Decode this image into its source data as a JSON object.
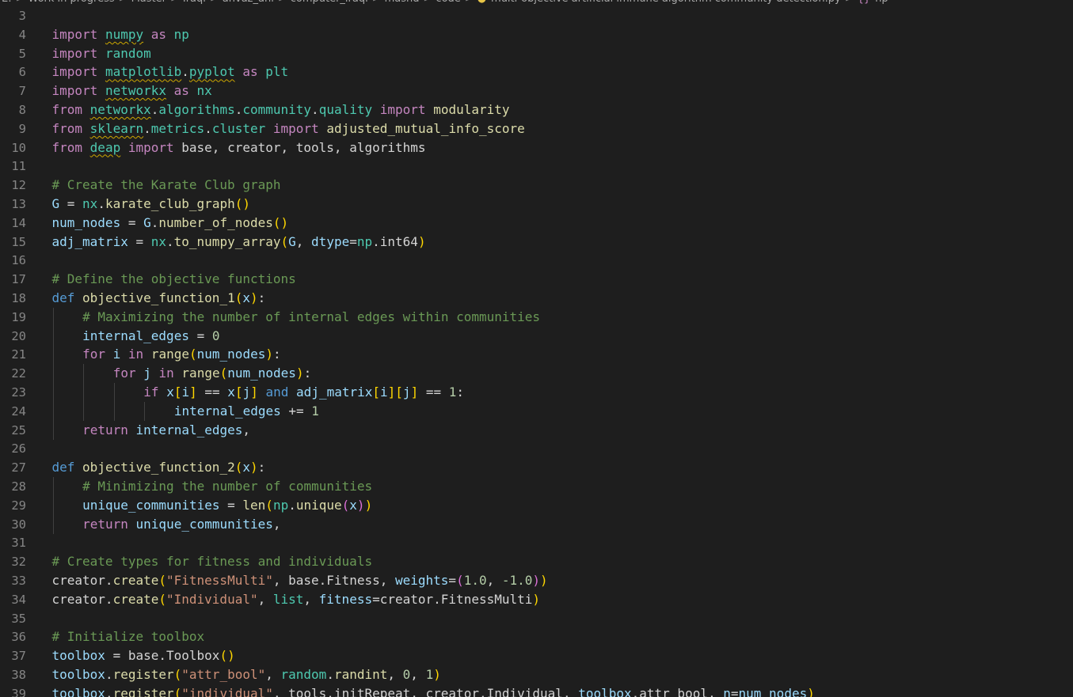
{
  "breadcrumb": {
    "items": [
      "E:",
      "Work in progress",
      "Master",
      "Iraqi",
      "anvaz_ahi",
      "computer_iraqi",
      "mashd",
      "code",
      "multi-objective artificial immune algorithm community detection.py",
      "np"
    ],
    "file_icon": "python-file-icon",
    "symbol_icon": "symbol-braces-icon"
  },
  "editor": {
    "language": "python",
    "theme_colors": {
      "background": "#1e1e1e",
      "keyword": "#c586c0",
      "module": "#4ec9b0",
      "function": "#dcdcaa",
      "variable": "#9cdcfe",
      "comment": "#6a9955",
      "string": "#ce9178",
      "number": "#b5cea8",
      "warning_squiggle": "#cca700"
    },
    "lines": [
      {
        "n": "3",
        "tokens": []
      },
      {
        "n": "4",
        "tokens": [
          [
            "kw",
            "import"
          ],
          [
            "op",
            " "
          ],
          [
            "mod wavy",
            "numpy"
          ],
          [
            "op",
            " "
          ],
          [
            "kw",
            "as"
          ],
          [
            "op",
            " "
          ],
          [
            "mod",
            "np"
          ]
        ]
      },
      {
        "n": "5",
        "tokens": [
          [
            "kw",
            "import"
          ],
          [
            "op",
            " "
          ],
          [
            "mod",
            "random"
          ]
        ]
      },
      {
        "n": "6",
        "tokens": [
          [
            "kw",
            "import"
          ],
          [
            "op",
            " "
          ],
          [
            "mod wavy",
            "matplotlib"
          ],
          [
            "pun",
            "."
          ],
          [
            "mod wavy",
            "pyplot"
          ],
          [
            "op",
            " "
          ],
          [
            "kw",
            "as"
          ],
          [
            "op",
            " "
          ],
          [
            "mod",
            "plt"
          ]
        ]
      },
      {
        "n": "7",
        "tokens": [
          [
            "kw",
            "import"
          ],
          [
            "op",
            " "
          ],
          [
            "mod wavy",
            "networkx"
          ],
          [
            "op",
            " "
          ],
          [
            "kw",
            "as"
          ],
          [
            "op",
            " "
          ],
          [
            "mod",
            "nx"
          ]
        ]
      },
      {
        "n": "8",
        "tokens": [
          [
            "kw",
            "from"
          ],
          [
            "op",
            " "
          ],
          [
            "mod wavy",
            "networkx"
          ],
          [
            "pun",
            "."
          ],
          [
            "mod",
            "algorithms"
          ],
          [
            "pun",
            "."
          ],
          [
            "mod",
            "community"
          ],
          [
            "pun",
            "."
          ],
          [
            "mod",
            "quality"
          ],
          [
            "op",
            " "
          ],
          [
            "kw",
            "import"
          ],
          [
            "op",
            " "
          ],
          [
            "fn",
            "modularity"
          ]
        ]
      },
      {
        "n": "9",
        "tokens": [
          [
            "kw",
            "from"
          ],
          [
            "op",
            " "
          ],
          [
            "mod wavy",
            "sklearn"
          ],
          [
            "pun",
            "."
          ],
          [
            "mod",
            "metrics"
          ],
          [
            "pun",
            "."
          ],
          [
            "mod",
            "cluster"
          ],
          [
            "op",
            " "
          ],
          [
            "kw",
            "import"
          ],
          [
            "op",
            " "
          ],
          [
            "fn",
            "adjusted_mutual_info_score"
          ]
        ]
      },
      {
        "n": "10",
        "tokens": [
          [
            "kw",
            "from"
          ],
          [
            "op",
            " "
          ],
          [
            "mod wavy",
            "deap"
          ],
          [
            "op",
            " "
          ],
          [
            "kw",
            "import"
          ],
          [
            "op",
            " base, creator, tools, algorithms"
          ]
        ]
      },
      {
        "n": "11",
        "tokens": []
      },
      {
        "n": "12",
        "tokens": [
          [
            "cmt",
            "# Create the Karate Club graph"
          ]
        ]
      },
      {
        "n": "13",
        "tokens": [
          [
            "var",
            "G"
          ],
          [
            "op",
            " = "
          ],
          [
            "mod",
            "nx"
          ],
          [
            "pun",
            "."
          ],
          [
            "fn",
            "karate_club_graph"
          ],
          [
            "br1",
            "()"
          ]
        ]
      },
      {
        "n": "14",
        "tokens": [
          [
            "var",
            "num_nodes"
          ],
          [
            "op",
            " = "
          ],
          [
            "var",
            "G"
          ],
          [
            "pun",
            "."
          ],
          [
            "fn",
            "number_of_nodes"
          ],
          [
            "br1",
            "()"
          ]
        ]
      },
      {
        "n": "15",
        "tokens": [
          [
            "var",
            "adj_matrix"
          ],
          [
            "op",
            " = "
          ],
          [
            "mod",
            "nx"
          ],
          [
            "pun",
            "."
          ],
          [
            "fn",
            "to_numpy_array"
          ],
          [
            "br1",
            "("
          ],
          [
            "var",
            "G"
          ],
          [
            "pun",
            ", "
          ],
          [
            "var",
            "dtype"
          ],
          [
            "op",
            "="
          ],
          [
            "mod",
            "np"
          ],
          [
            "pun",
            "."
          ],
          [
            "op",
            "int64"
          ],
          [
            "br1",
            ")"
          ]
        ]
      },
      {
        "n": "16",
        "tokens": []
      },
      {
        "n": "17",
        "tokens": [
          [
            "cmt",
            "# Define the objective functions"
          ]
        ]
      },
      {
        "n": "18",
        "tokens": [
          [
            "kwb",
            "def"
          ],
          [
            "op",
            " "
          ],
          [
            "fn",
            "objective_function_1"
          ],
          [
            "br1",
            "("
          ],
          [
            "var",
            "x"
          ],
          [
            "br1",
            ")"
          ],
          [
            "pun",
            ":"
          ]
        ]
      },
      {
        "n": "19",
        "indent": 1,
        "tokens": [
          [
            "cmt",
            "# Maximizing the number of internal edges within communities"
          ]
        ]
      },
      {
        "n": "20",
        "indent": 1,
        "tokens": [
          [
            "var",
            "internal_edges"
          ],
          [
            "op",
            " = "
          ],
          [
            "num",
            "0"
          ]
        ]
      },
      {
        "n": "21",
        "indent": 1,
        "tokens": [
          [
            "kw",
            "for"
          ],
          [
            "op",
            " "
          ],
          [
            "var",
            "i"
          ],
          [
            "op",
            " "
          ],
          [
            "kw",
            "in"
          ],
          [
            "op",
            " "
          ],
          [
            "fn",
            "range"
          ],
          [
            "br1",
            "("
          ],
          [
            "var",
            "num_nodes"
          ],
          [
            "br1",
            ")"
          ],
          [
            "pun",
            ":"
          ]
        ]
      },
      {
        "n": "22",
        "indent": 2,
        "tokens": [
          [
            "kw",
            "for"
          ],
          [
            "op",
            " "
          ],
          [
            "var",
            "j"
          ],
          [
            "op",
            " "
          ],
          [
            "kw",
            "in"
          ],
          [
            "op",
            " "
          ],
          [
            "fn",
            "range"
          ],
          [
            "br1",
            "("
          ],
          [
            "var",
            "num_nodes"
          ],
          [
            "br1",
            ")"
          ],
          [
            "pun",
            ":"
          ]
        ]
      },
      {
        "n": "23",
        "indent": 3,
        "tokens": [
          [
            "kw",
            "if"
          ],
          [
            "op",
            " "
          ],
          [
            "var",
            "x"
          ],
          [
            "br1",
            "["
          ],
          [
            "var",
            "i"
          ],
          [
            "br1",
            "]"
          ],
          [
            "op",
            " == "
          ],
          [
            "var",
            "x"
          ],
          [
            "br1",
            "["
          ],
          [
            "var",
            "j"
          ],
          [
            "br1",
            "]"
          ],
          [
            "op",
            " "
          ],
          [
            "kwb",
            "and"
          ],
          [
            "op",
            " "
          ],
          [
            "var",
            "adj_matrix"
          ],
          [
            "br1",
            "["
          ],
          [
            "var",
            "i"
          ],
          [
            "br1",
            "]["
          ],
          [
            "var",
            "j"
          ],
          [
            "br1",
            "]"
          ],
          [
            "op",
            " == "
          ],
          [
            "num",
            "1"
          ],
          [
            "pun",
            ":"
          ]
        ]
      },
      {
        "n": "24",
        "indent": 4,
        "tokens": [
          [
            "var",
            "internal_edges"
          ],
          [
            "op",
            " += "
          ],
          [
            "num",
            "1"
          ]
        ]
      },
      {
        "n": "25",
        "indent": 1,
        "tokens": [
          [
            "kw",
            "return"
          ],
          [
            "op",
            " "
          ],
          [
            "var",
            "internal_edges"
          ],
          [
            "pun",
            ","
          ]
        ]
      },
      {
        "n": "26",
        "tokens": []
      },
      {
        "n": "27",
        "tokens": [
          [
            "kwb",
            "def"
          ],
          [
            "op",
            " "
          ],
          [
            "fn",
            "objective_function_2"
          ],
          [
            "br1",
            "("
          ],
          [
            "var",
            "x"
          ],
          [
            "br1",
            ")"
          ],
          [
            "pun",
            ":"
          ]
        ]
      },
      {
        "n": "28",
        "indent": 1,
        "tokens": [
          [
            "cmt",
            "# Minimizing the number of communities"
          ]
        ]
      },
      {
        "n": "29",
        "indent": 1,
        "tokens": [
          [
            "var",
            "unique_communities"
          ],
          [
            "op",
            " = "
          ],
          [
            "fn",
            "len"
          ],
          [
            "br1",
            "("
          ],
          [
            "mod",
            "np"
          ],
          [
            "pun",
            "."
          ],
          [
            "fn",
            "unique"
          ],
          [
            "br2",
            "("
          ],
          [
            "var",
            "x"
          ],
          [
            "br2",
            ")"
          ],
          [
            "br1",
            ")"
          ]
        ]
      },
      {
        "n": "30",
        "indent": 1,
        "tokens": [
          [
            "kw",
            "return"
          ],
          [
            "op",
            " "
          ],
          [
            "var",
            "unique_communities"
          ],
          [
            "pun",
            ","
          ]
        ]
      },
      {
        "n": "31",
        "tokens": []
      },
      {
        "n": "32",
        "tokens": [
          [
            "cmt",
            "# Create types for fitness and individuals"
          ]
        ]
      },
      {
        "n": "33",
        "tokens": [
          [
            "op",
            "creator."
          ],
          [
            "fn",
            "create"
          ],
          [
            "br1",
            "("
          ],
          [
            "str",
            "\"FitnessMulti\""
          ],
          [
            "pun",
            ", base.Fitness, "
          ],
          [
            "var",
            "weights"
          ],
          [
            "op",
            "="
          ],
          [
            "br2",
            "("
          ],
          [
            "num",
            "1.0"
          ],
          [
            "pun",
            ", "
          ],
          [
            "num",
            "-1.0"
          ],
          [
            "br2",
            ")"
          ],
          [
            "br1",
            ")"
          ]
        ]
      },
      {
        "n": "34",
        "tokens": [
          [
            "op",
            "creator."
          ],
          [
            "fn",
            "create"
          ],
          [
            "br1",
            "("
          ],
          [
            "str",
            "\"Individual\""
          ],
          [
            "pun",
            ", "
          ],
          [
            "cls",
            "list"
          ],
          [
            "pun",
            ", "
          ],
          [
            "var",
            "fitness"
          ],
          [
            "op",
            "=creator.FitnessMulti"
          ],
          [
            "br1",
            ")"
          ]
        ]
      },
      {
        "n": "35",
        "tokens": []
      },
      {
        "n": "36",
        "tokens": [
          [
            "cmt",
            "# Initialize toolbox"
          ]
        ]
      },
      {
        "n": "37",
        "tokens": [
          [
            "var",
            "toolbox"
          ],
          [
            "op",
            " = base.Toolbox"
          ],
          [
            "br1",
            "()"
          ]
        ]
      },
      {
        "n": "38",
        "tokens": [
          [
            "var",
            "toolbox"
          ],
          [
            "pun",
            "."
          ],
          [
            "fn",
            "register"
          ],
          [
            "br1",
            "("
          ],
          [
            "str",
            "\"attr_bool\""
          ],
          [
            "pun",
            ", "
          ],
          [
            "mod",
            "random"
          ],
          [
            "pun",
            "."
          ],
          [
            "fn",
            "randint"
          ],
          [
            "pun",
            ", "
          ],
          [
            "num",
            "0"
          ],
          [
            "pun",
            ", "
          ],
          [
            "num",
            "1"
          ],
          [
            "br1",
            ")"
          ]
        ]
      },
      {
        "n": "39",
        "tokens": [
          [
            "var",
            "toolbox"
          ],
          [
            "pun",
            "."
          ],
          [
            "fn",
            "register"
          ],
          [
            "br1",
            "("
          ],
          [
            "str",
            "\"individual\""
          ],
          [
            "pun",
            ", tools.initRepeat, creator.Individual, "
          ],
          [
            "var",
            "toolbox"
          ],
          [
            "pun",
            "."
          ],
          [
            "op",
            "attr_bool, "
          ],
          [
            "var",
            "n"
          ],
          [
            "op",
            "="
          ],
          [
            "var",
            "num_nodes"
          ],
          [
            "br1",
            ")"
          ]
        ]
      }
    ]
  }
}
